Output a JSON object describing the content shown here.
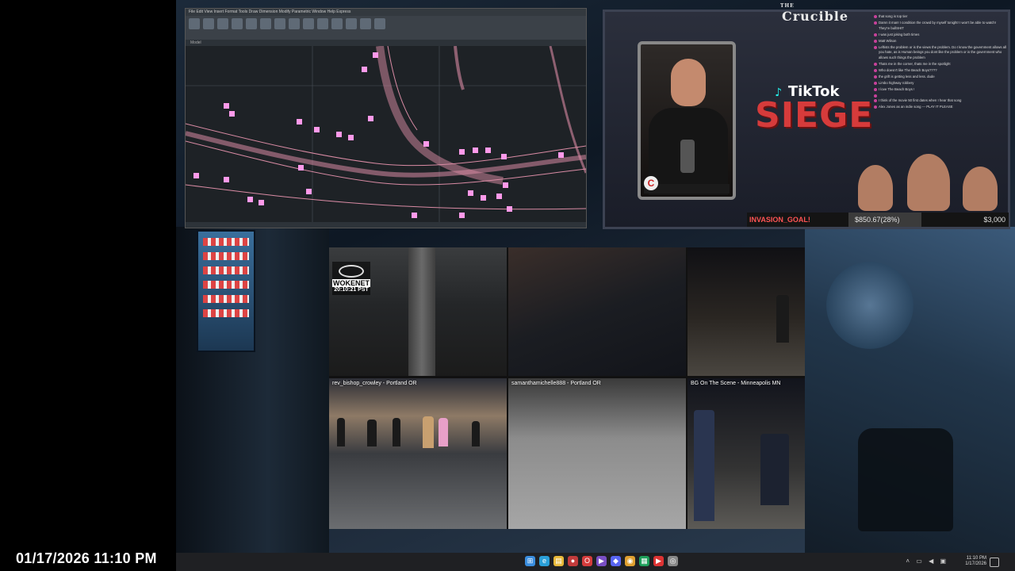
{
  "overlay": {
    "timestamp": "01/17/2026 11:10 PM"
  },
  "cad_window": {
    "menubar": "File  Edit  View  Insert  Format  Tools  Draw  Dimension  Modify  Parametric  Window  Help  Express",
    "tabs": "Model"
  },
  "stream": {
    "logo_small": "THE",
    "logo": "Crucible",
    "tiktok_label": "TikTok",
    "siege_label": "SIEGE",
    "webcam_logo": "C",
    "goal_label": "INVASION_GOAL!",
    "goal_amount": "$850.67(28%)",
    "goal_target": "$3,000",
    "goal_progress": 0.28,
    "chat": [
      {
        "user": "",
        "text": "that song is top tier"
      },
      {
        "user": "",
        "text": "Damn it man! I condition the crowd by myself tonight! I won't be able to watch! They're bullSHIT"
      },
      {
        "user": "",
        "text": "I was just joking both times"
      },
      {
        "user": "",
        "text": "Matt Wilson"
      },
      {
        "user": "",
        "text": "Leftists the problem or is the views the problem. Do I know the government allows all you hate, as is Human beings you dont like the problem or is the government who allows such things the problem"
      },
      {
        "user": "",
        "text": "Thats me in the corner, thats me in the spotlight"
      },
      {
        "user": "",
        "text": "Who doesn't like The Beach Boys????"
      },
      {
        "user": "",
        "text": "the grift is getting less and less. dude"
      },
      {
        "user": "",
        "text": "Limbo highway robbery"
      },
      {
        "user": "",
        "text": "I love The Beach Boys !"
      },
      {
        "user": "",
        "text": ""
      },
      {
        "user": "",
        "text": "I think of the movie 50 first dates when I hear that song"
      },
      {
        "user": "",
        "text": "Alex Jones as an indie song --- PLAY IT PLEASE"
      }
    ]
  },
  "video_grid": {
    "tile1": {
      "badge_brand": "WOKENET",
      "badge_time": "20:10:21 PST"
    },
    "tile4": {
      "label": "rev_bishop_crowley - Portland OR"
    },
    "tile5": {
      "label": "samanthamichelle888 - Portland OR"
    },
    "tile6": {
      "label": "BG On The Scene - Minneapolis MN"
    }
  },
  "taskbar": {
    "time": "11:10 PM",
    "date": "1/17/2026",
    "apps": [
      "start",
      "edge",
      "explorer",
      "record",
      "opera",
      "media",
      "chat",
      "chrome",
      "sheets",
      "player",
      "camera"
    ]
  },
  "colors": {
    "siege_red": "#d63b3b",
    "goal_red": "#ff5454",
    "cad_marker": "#ff9aea",
    "cad_line": "#d98ba4"
  }
}
